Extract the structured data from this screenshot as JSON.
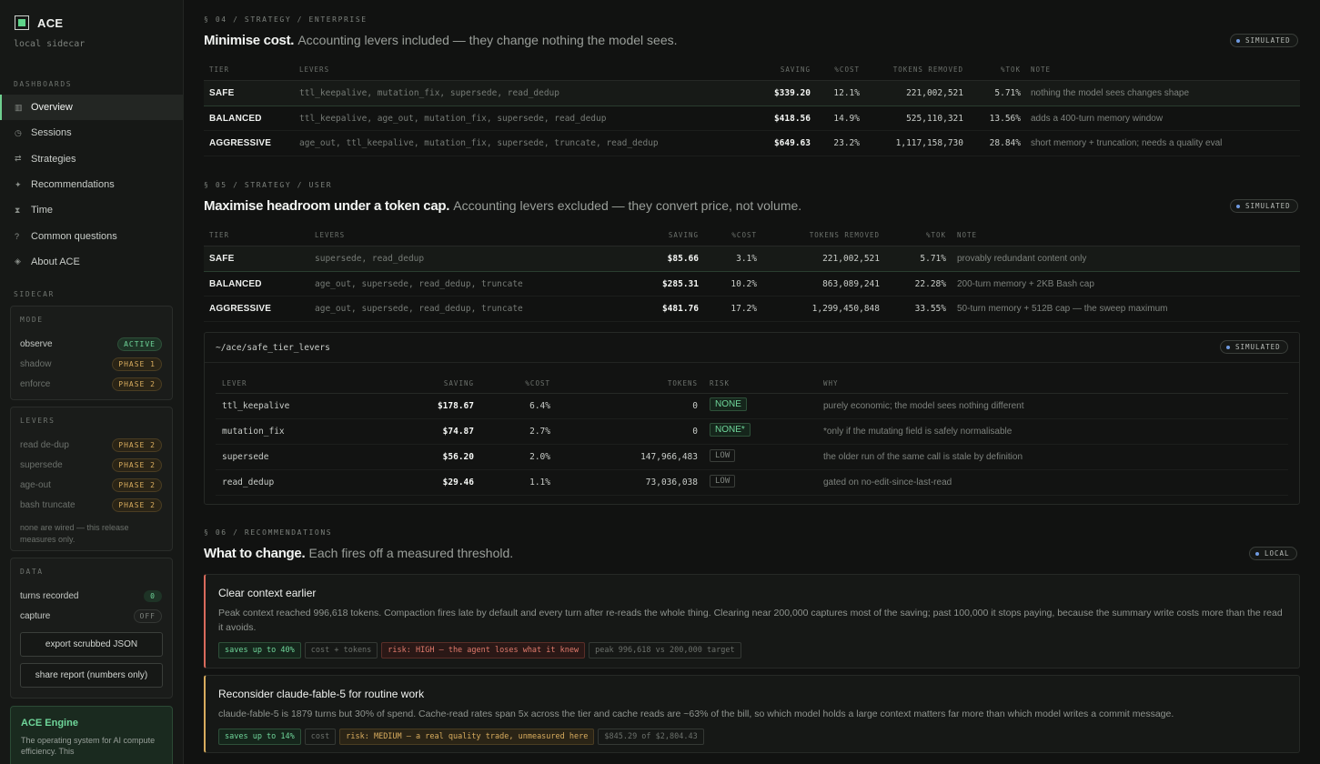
{
  "sidebar": {
    "brand": "ACE",
    "subtitle": "local sidecar",
    "dashboards_label": "DASHBOARDS",
    "nav": [
      {
        "icon": "▥",
        "label": "Overview"
      },
      {
        "icon": "◷",
        "label": "Sessions"
      },
      {
        "icon": "⇄",
        "label": "Strategies"
      },
      {
        "icon": "✦",
        "label": "Recommendations"
      },
      {
        "icon": "⧗",
        "label": "Time"
      },
      {
        "icon": "?",
        "label": "Common questions"
      },
      {
        "icon": "◈",
        "label": "About ACE"
      }
    ],
    "sidecar_label": "SIDECAR",
    "mode": {
      "label": "MODE",
      "rows": [
        {
          "label": "observe",
          "chip": "ACTIVE"
        },
        {
          "label": "shadow",
          "chip": "PHASE 1"
        },
        {
          "label": "enforce",
          "chip": "PHASE 2"
        }
      ]
    },
    "levers": {
      "label": "LEVERS",
      "rows": [
        {
          "label": "read de-dup",
          "chip": "PHASE 2"
        },
        {
          "label": "supersede",
          "chip": "PHASE 2"
        },
        {
          "label": "age-out",
          "chip": "PHASE 2"
        },
        {
          "label": "bash truncate",
          "chip": "PHASE 2"
        }
      ],
      "note": "none are wired — this release measures only."
    },
    "data": {
      "label": "DATA",
      "turns_label": "turns recorded",
      "turns_value": "0",
      "capture_label": "capture",
      "capture_value": "OFF",
      "export_button": "export scrubbed JSON",
      "share_button": "share report (numbers only)"
    },
    "engine": {
      "title": "ACE Engine",
      "desc": "The operating system for AI compute efficiency. This"
    }
  },
  "enterprise": {
    "eyebrow": "§ 04 / STRATEGY / ENTERPRISE",
    "title": "Minimise cost.",
    "subtitle": "Accounting levers included — they change nothing the model sees.",
    "badge": "SIMULATED",
    "columns": [
      "TIER",
      "LEVERS",
      "SAVING",
      "%COST",
      "TOKENS REMOVED",
      "%TOK",
      "NOTE"
    ],
    "rows": [
      {
        "tier": "SAFE",
        "levers": "ttl_keepalive, mutation_fix, supersede, read_dedup",
        "saving": "$339.20",
        "cost": "12.1%",
        "tokens": "221,002,521",
        "tok": "5.71%",
        "note": "nothing the model sees changes shape"
      },
      {
        "tier": "BALANCED",
        "levers": "ttl_keepalive, age_out, mutation_fix, supersede, read_dedup",
        "saving": "$418.56",
        "cost": "14.9%",
        "tokens": "525,110,321",
        "tok": "13.56%",
        "note": "adds a 400-turn memory window"
      },
      {
        "tier": "AGGRESSIVE",
        "levers": "age_out, ttl_keepalive, mutation_fix, supersede, truncate, read_dedup",
        "saving": "$649.63",
        "cost": "23.2%",
        "tokens": "1,117,158,730",
        "tok": "28.84%",
        "note": "short memory + truncation; needs a quality eval"
      }
    ]
  },
  "user": {
    "eyebrow": "§ 05 / STRATEGY / USER",
    "title": "Maximise headroom under a token cap.",
    "subtitle": "Accounting levers excluded — they convert price, not volume.",
    "badge": "SIMULATED",
    "columns": [
      "TIER",
      "LEVERS",
      "SAVING",
      "%COST",
      "TOKENS REMOVED",
      "%TOK",
      "NOTE"
    ],
    "rows": [
      {
        "tier": "SAFE",
        "levers": "supersede, read_dedup",
        "saving": "$85.66",
        "cost": "3.1%",
        "tokens": "221,002,521",
        "tok": "5.71%",
        "note": "provably redundant content only"
      },
      {
        "tier": "BALANCED",
        "levers": "age_out, supersede, read_dedup, truncate",
        "saving": "$285.31",
        "cost": "10.2%",
        "tokens": "863,089,241",
        "tok": "22.28%",
        "note": "200-turn memory + 2KB Bash cap"
      },
      {
        "tier": "AGGRESSIVE",
        "levers": "age_out, supersede, read_dedup, truncate",
        "saving": "$481.76",
        "cost": "17.2%",
        "tokens": "1,299,450,848",
        "tok": "33.55%",
        "note": "50-turn memory + 512B cap — the sweep maximum"
      }
    ]
  },
  "safe_levers": {
    "title": "~/ace/safe_tier_levers",
    "badge": "SIMULATED",
    "columns": [
      "LEVER",
      "SAVING",
      "%COST",
      "TOKENS",
      "RISK",
      "WHY"
    ],
    "rows": [
      {
        "lever": "ttl_keepalive",
        "saving": "$178.67",
        "cost": "6.4%",
        "tokens": "0",
        "risk": "NONE",
        "why": "purely economic; the model sees nothing different"
      },
      {
        "lever": "mutation_fix",
        "saving": "$74.87",
        "cost": "2.7%",
        "tokens": "0",
        "risk": "NONE*",
        "why": "*only if the mutating field is safely normalisable"
      },
      {
        "lever": "supersede",
        "saving": "$56.20",
        "cost": "2.0%",
        "tokens": "147,966,483",
        "risk": "LOW",
        "why": "the older run of the same call is stale by definition"
      },
      {
        "lever": "read_dedup",
        "saving": "$29.46",
        "cost": "1.1%",
        "tokens": "73,036,038",
        "risk": "LOW",
        "why": "gated on no-edit-since-last-read"
      }
    ]
  },
  "recommendations": {
    "eyebrow": "§ 06 / RECOMMENDATIONS",
    "title": "What to change.",
    "subtitle": "Each fires off a measured threshold.",
    "badge": "LOCAL",
    "items": [
      {
        "title": "Clear context earlier",
        "body": "Peak context reached 996,618 tokens. Compaction fires late by default and every turn after re-reads the whole thing. Clearing near 200,000 captures most of the saving; past 100,000 it stops paying, because the summary write costs more than the read it avoids.",
        "tags": [
          "saves up to 40%",
          "cost + tokens",
          "risk: HIGH — the agent loses what it knew",
          "peak 996,618 vs 200,000 target"
        ]
      },
      {
        "title": "Reconsider claude-fable-5 for routine work",
        "body": "claude-fable-5 is 1879 turns but 30% of spend. Cache-read rates span 5x across the tier and cache reads are ~63% of the bill, so which model holds a large context matters far more than which model writes a commit message.",
        "tags": [
          "saves up to 14%",
          "cost",
          "risk: MEDIUM — a real quality trade, unmeasured here",
          "$845.29 of $2,804.43"
        ]
      }
    ]
  },
  "colors": {
    "accent_green": "#6fd69a",
    "amber": "#d8ac5e",
    "red": "#d86a5c",
    "badge_dot": "#6f9ae0"
  }
}
